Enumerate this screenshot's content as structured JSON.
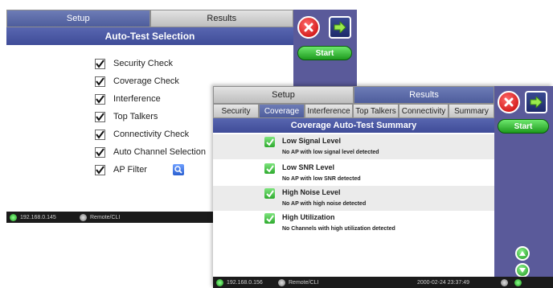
{
  "back_window": {
    "tabs": [
      {
        "label": "Setup",
        "active": true
      },
      {
        "label": "Results",
        "active": false
      }
    ],
    "title": "Auto-Test Selection",
    "start_label": "Start",
    "checklist": [
      {
        "label": "Security Check",
        "checked": true
      },
      {
        "label": "Coverage Check",
        "checked": true
      },
      {
        "label": "Interference",
        "checked": true
      },
      {
        "label": "Top Talkers",
        "checked": true
      },
      {
        "label": "Connectivity Check",
        "checked": true
      },
      {
        "label": "Auto Channel Selection",
        "checked": true
      },
      {
        "label": "AP Filter",
        "checked": true
      }
    ],
    "status": {
      "ip": "192.168.0.145",
      "remote": "Remote/CLI"
    }
  },
  "front_window": {
    "tabs": [
      {
        "label": "Setup",
        "active": false
      },
      {
        "label": "Results",
        "active": true
      }
    ],
    "subtabs": [
      "Security",
      "Coverage",
      "Interference",
      "Top Talkers",
      "Connectivity",
      "Summary"
    ],
    "active_subtab": "Coverage",
    "title": "Coverage Auto-Test Summary",
    "start_label": "Start",
    "summary": [
      {
        "title": "Low Signal Level",
        "detail": "No AP with low signal level detected"
      },
      {
        "title": "Low SNR Level",
        "detail": "No AP with low SNR detected"
      },
      {
        "title": "High Noise Level",
        "detail": "No AP with high noise detected"
      },
      {
        "title": "High Utilization",
        "detail": "No Channels with high utilization detected"
      }
    ],
    "status": {
      "ip": "192.168.0.156",
      "remote": "Remote/CLI",
      "datetime": "2000-02-24 23:37:49"
    }
  },
  "colors": {
    "accent": "#4e5d9c",
    "start_green": "#2eaa2e",
    "close_red": "#c40000"
  },
  "icons": [
    "close-icon",
    "next-arrow-icon",
    "checkbox-check-icon",
    "search-filter-icon",
    "scroll-up-icon",
    "scroll-down-icon"
  ]
}
